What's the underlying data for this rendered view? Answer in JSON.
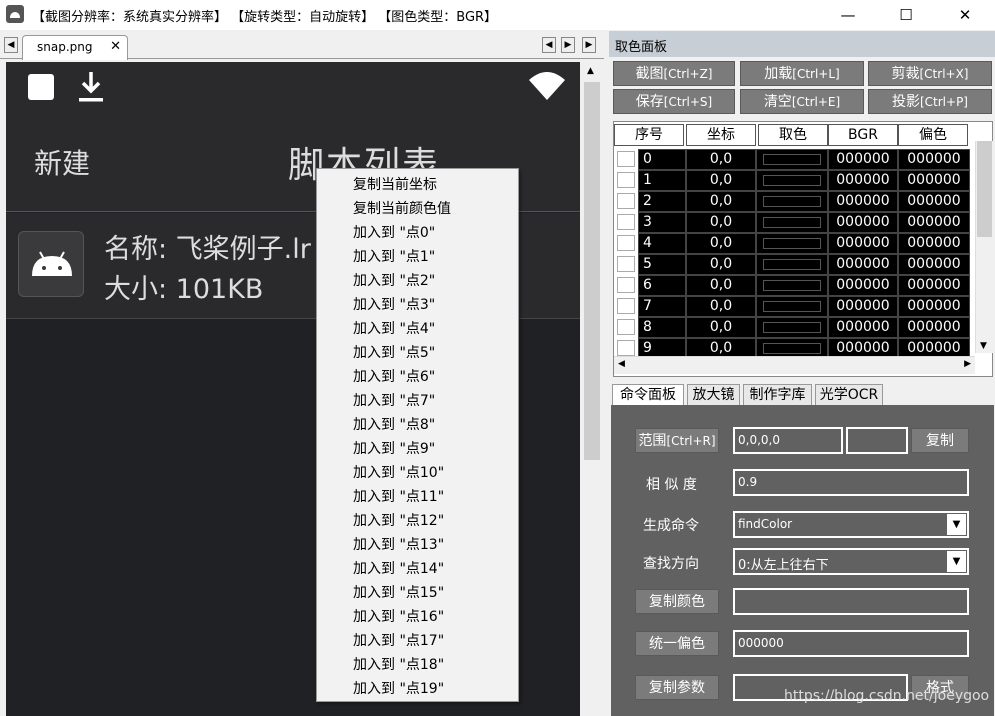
{
  "window": {
    "title": "【截图分辨率：系统真实分辨率】 【旋转类型：自动旋转】 【图色类型：BGR】",
    "minimize": "—",
    "maximize": "☐",
    "close": "✕"
  },
  "tabs": {
    "file": "snap.png",
    "close": "✕",
    "first": "◀",
    "prev": "◀",
    "next": "▶",
    "last": "▶"
  },
  "phone": {
    "new_label": "新建",
    "list_title": "脚本列表",
    "item_name": "名称: 飞桨例子.lr",
    "item_size": "大小: 101KB"
  },
  "context_menu": [
    "复制当前坐标",
    "复制当前颜色值",
    "加入到 \"点0\"",
    "加入到 \"点1\"",
    "加入到 \"点2\"",
    "加入到 \"点3\"",
    "加入到 \"点4\"",
    "加入到 \"点5\"",
    "加入到 \"点6\"",
    "加入到 \"点7\"",
    "加入到 \"点8\"",
    "加入到 \"点9\"",
    "加入到 \"点10\"",
    "加入到 \"点11\"",
    "加入到 \"点12\"",
    "加入到 \"点13\"",
    "加入到 \"点14\"",
    "加入到 \"点15\"",
    "加入到 \"点16\"",
    "加入到 \"点17\"",
    "加入到 \"点18\"",
    "加入到 \"点19\""
  ],
  "color_panel": {
    "title": "取色面板",
    "buttons": [
      {
        "label": "截图",
        "key": "[Ctrl+Z]"
      },
      {
        "label": "加载",
        "key": "[Ctrl+L]"
      },
      {
        "label": "剪裁",
        "key": "[Ctrl+X]"
      },
      {
        "label": "保存",
        "key": "[Ctrl+S]"
      },
      {
        "label": "清空",
        "key": "[Ctrl+E]"
      },
      {
        "label": "投影",
        "key": "[Ctrl+P]"
      }
    ],
    "columns": [
      "序号",
      "坐标",
      "取色",
      "BGR",
      "偏色"
    ],
    "rows": [
      {
        "idx": "0",
        "coord": "0,0",
        "bgr": "000000",
        "offset": "000000"
      },
      {
        "idx": "1",
        "coord": "0,0",
        "bgr": "000000",
        "offset": "000000"
      },
      {
        "idx": "2",
        "coord": "0,0",
        "bgr": "000000",
        "offset": "000000"
      },
      {
        "idx": "3",
        "coord": "0,0",
        "bgr": "000000",
        "offset": "000000"
      },
      {
        "idx": "4",
        "coord": "0,0",
        "bgr": "000000",
        "offset": "000000"
      },
      {
        "idx": "5",
        "coord": "0,0",
        "bgr": "000000",
        "offset": "000000"
      },
      {
        "idx": "6",
        "coord": "0,0",
        "bgr": "000000",
        "offset": "000000"
      },
      {
        "idx": "7",
        "coord": "0,0",
        "bgr": "000000",
        "offset": "000000"
      },
      {
        "idx": "8",
        "coord": "0,0",
        "bgr": "000000",
        "offset": "000000"
      },
      {
        "idx": "9",
        "coord": "0,0",
        "bgr": "000000",
        "offset": "000000"
      }
    ]
  },
  "panel_tabs": [
    "命令面板",
    "放大镜",
    "制作字库",
    "光学OCR"
  ],
  "command": {
    "range_label": "范围",
    "range_key": "[Ctrl+R]",
    "range_value": "0,0,0,0",
    "copy": "复制",
    "similarity_label": "相 似 度",
    "similarity_value": "0.9",
    "gen_label": "生成命令",
    "gen_value": "findColor",
    "dir_label": "查找方向",
    "dir_value": "0:从左上往右下",
    "copy_color": "复制颜色",
    "unify_offset": "统一偏色",
    "offset_value": "000000",
    "copy_params": "复制参数",
    "format": "格式"
  },
  "watermark": "https://blog.csdn.net/joeygoo",
  "colors": {
    "phone_bg": "#202124",
    "panel_bg": "#616161",
    "button_bg": "#7b7b7b"
  }
}
